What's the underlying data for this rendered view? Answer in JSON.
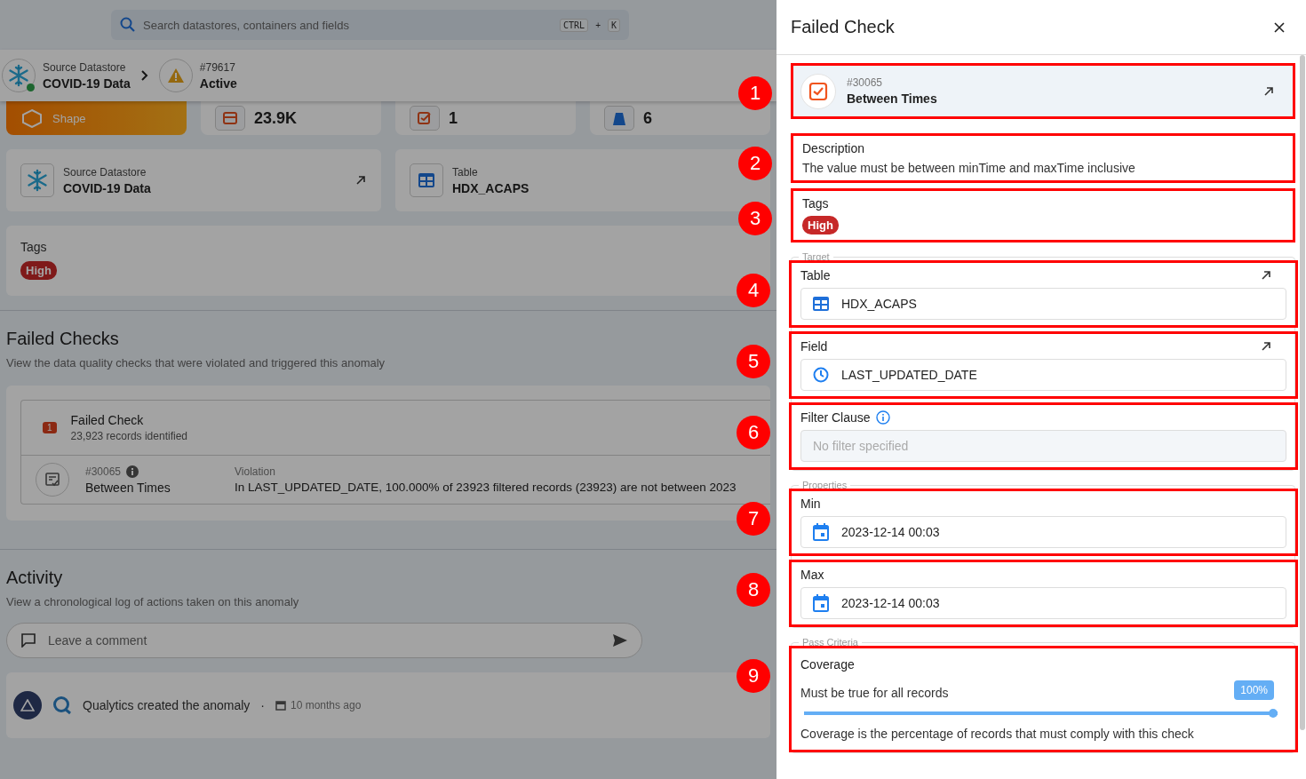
{
  "search": {
    "placeholder": "Search datastores, containers and fields",
    "shortcut": [
      "CTRL",
      "+",
      "K"
    ]
  },
  "breadcrumb": [
    {
      "kind": "datastore",
      "label": "Source Datastore",
      "value": "COVID-19 Data"
    },
    {
      "kind": "anomaly",
      "label": "#79617",
      "value": "Active"
    }
  ],
  "stats": [
    {
      "kind": "shape",
      "value": "Shape"
    },
    {
      "kind": "records",
      "value": "23.9K"
    },
    {
      "kind": "checks",
      "value": "1"
    },
    {
      "kind": "fields",
      "value": "6"
    }
  ],
  "info_cards": [
    {
      "kind": "datastore",
      "label": "Source Datastore",
      "value": "COVID-19 Data",
      "link": true
    },
    {
      "kind": "table",
      "label": "Table",
      "value": "HDX_ACAPS",
      "link": false
    }
  ],
  "tags_card": {
    "title": "Tags",
    "tags": [
      {
        "label": "High"
      }
    ]
  },
  "failed_checks": {
    "title": "Failed Checks",
    "subtitle": "View the data quality checks that were violated and triggered this anomaly",
    "summary": {
      "count": "1",
      "title": "Failed Check",
      "subtitle": "23,923 records identified"
    },
    "checks": [
      {
        "id": "#30065",
        "name": "Between Times",
        "violation_label": "Violation",
        "violation": "In LAST_UPDATED_DATE, 100.000% of 23923 filtered records (23923) are not between 2023"
      }
    ]
  },
  "activity": {
    "title": "Activity",
    "subtitle": "View a chronological log of actions taken on this anomaly",
    "comment_placeholder": "Leave a comment",
    "events": [
      {
        "text": "Qualytics created the anomaly",
        "separator": "·",
        "time": "10 months ago"
      }
    ]
  },
  "drawer": {
    "title": "Failed Check",
    "check": {
      "id": "#30065",
      "name": "Between Times"
    },
    "description": {
      "label": "Description",
      "text": "The value must be between minTime and maxTime inclusive"
    },
    "tags": {
      "label": "Tags",
      "items": [
        {
          "label": "High",
          "color": "#c62828"
        }
      ]
    },
    "target": {
      "legend": "Target",
      "table": {
        "label": "Table",
        "value": "HDX_ACAPS"
      },
      "field": {
        "label": "Field",
        "value": "LAST_UPDATED_DATE"
      },
      "filter": {
        "label": "Filter Clause",
        "placeholder": "No filter specified"
      }
    },
    "properties": {
      "legend": "Properties",
      "items": [
        {
          "label": "Min",
          "value": "2023-12-14 00:03"
        },
        {
          "label": "Max",
          "value": "2023-12-14 00:03"
        }
      ]
    },
    "pass_criteria": {
      "legend": "Pass Criteria",
      "label": "Coverage",
      "requirement": "Must be true for all records",
      "level": 1,
      "reading": "100%",
      "help": "Coverage is the percentage of records that must comply with this check"
    }
  },
  "callouts": [
    "1",
    "2",
    "3",
    "4",
    "5",
    "6",
    "7",
    "8",
    "9"
  ]
}
